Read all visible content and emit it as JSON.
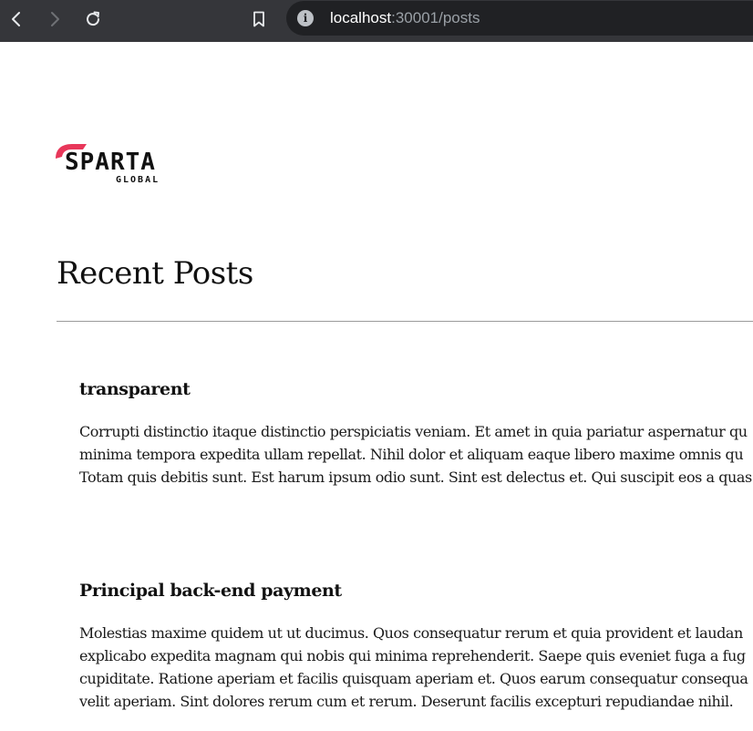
{
  "browser": {
    "url_host": "localhost",
    "url_rest": ":30001/posts"
  },
  "logo": {
    "name": "SPARTA",
    "sub": "GLOBAL",
    "accent_color": "#e8375a"
  },
  "page": {
    "title": "Recent Posts"
  },
  "posts": [
    {
      "title": "transparent",
      "lines": [
        "Corrupti distinctio itaque distinctio perspiciatis veniam. Et amet in quia pariatur aspernatur qu",
        "minima tempora expedita ullam repellat. Nihil dolor et aliquam eaque libero maxime omnis qu",
        "Totam quis debitis sunt. Est harum ipsum odio sunt. Sint est delectus et. Qui suscipit eos a quas"
      ]
    },
    {
      "title": "Principal back-end payment",
      "lines": [
        "Molestias maxime quidem ut ut ducimus. Quos consequatur rerum et quia provident et laudan",
        "explicabo expedita magnam qui nobis qui minima reprehenderit. Saepe quis eveniet fuga a fug",
        "cupiditate. Ratione aperiam et facilis quisquam aperiam et. Quos earum consequatur consequa",
        "velit aperiam. Sint dolores rerum cum et rerum. Deserunt facilis excepturi repudiandae nihil."
      ]
    }
  ]
}
